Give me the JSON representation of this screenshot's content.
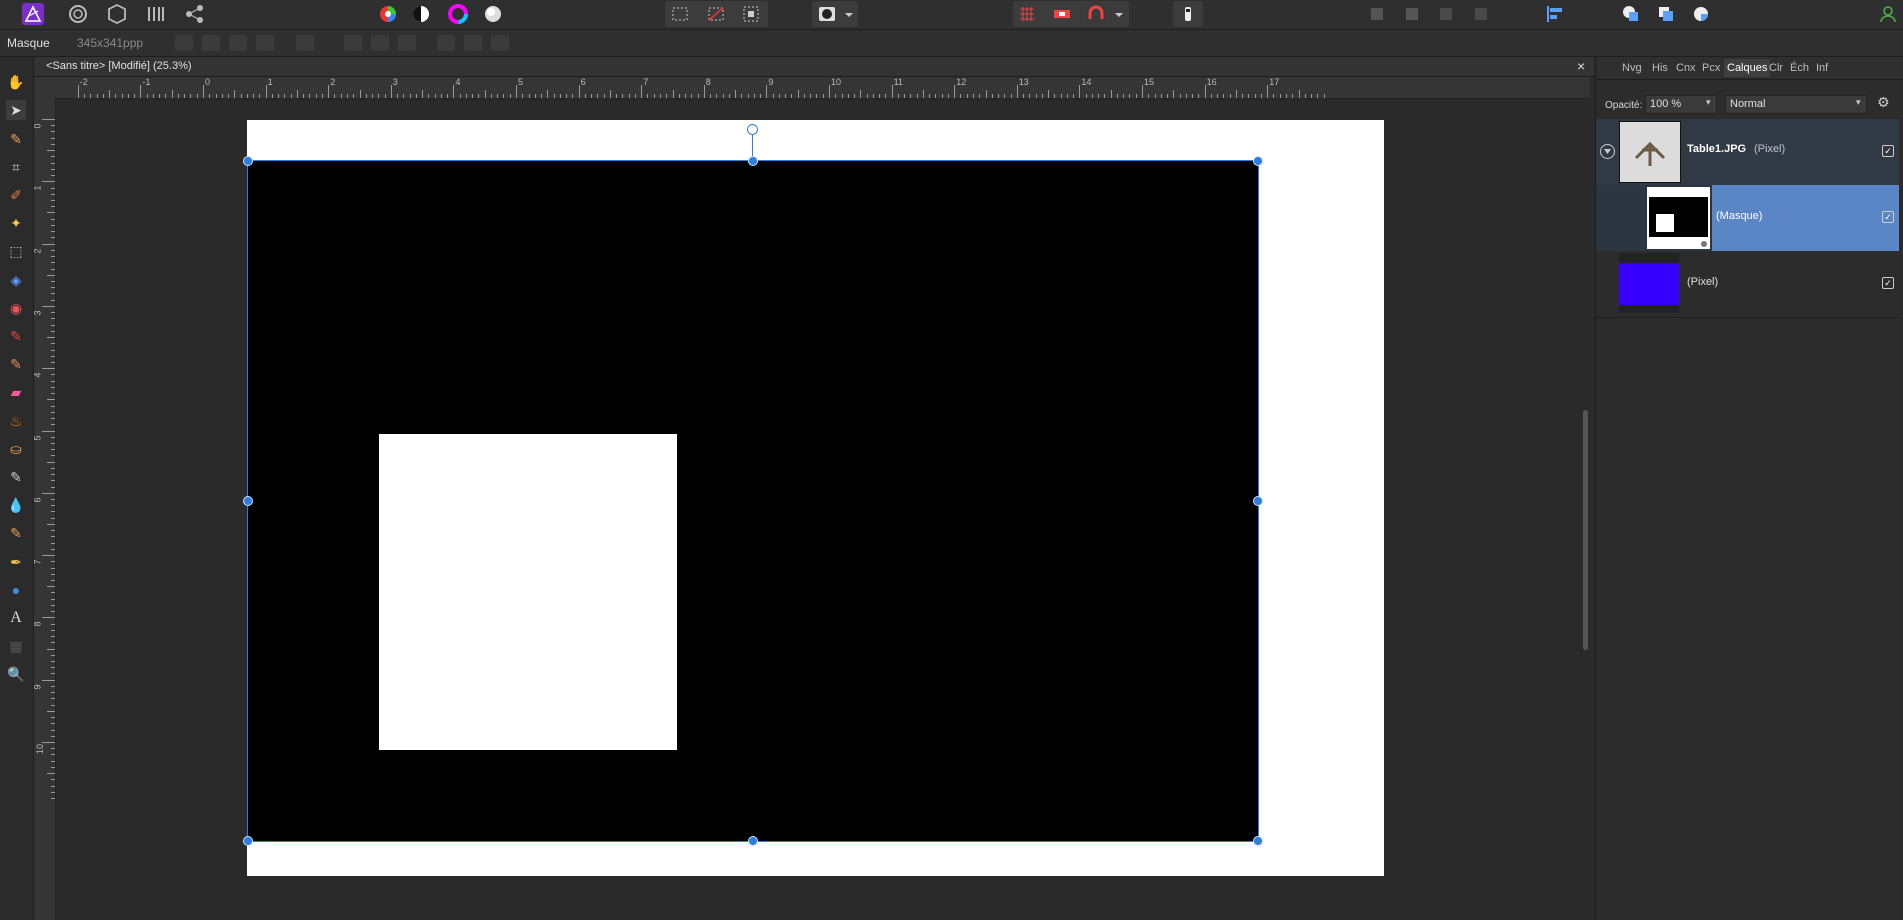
{
  "context": {
    "mode_label": "Masque",
    "dimensions": "345x341ppp"
  },
  "document": {
    "tab_title": "<Sans titre> [Modifié] (25.3%)",
    "close_glyph": "×"
  },
  "ruler": {
    "h_labels": [
      "-2",
      "-1",
      "0",
      "1",
      "2",
      "3",
      "4",
      "5",
      "6",
      "7",
      "8",
      "9",
      "10",
      "11",
      "12",
      "13",
      "14",
      "15",
      "16",
      "17"
    ],
    "v_labels": [
      "0",
      "1",
      "2",
      "3",
      "4",
      "5",
      "6",
      "7",
      "8",
      "9",
      "10"
    ]
  },
  "panel": {
    "tabs": [
      "Nvg",
      "His",
      "Cnx",
      "Pcx",
      "Calques",
      "Clr",
      "Éch",
      "Inf"
    ],
    "active_tab": "Calques",
    "opacity_label": "Opacité:",
    "opacity_value": "100 %",
    "blend_mode": "Normal",
    "layers": [
      {
        "name": "Table1.JPG",
        "type": "(Pixel)",
        "checked": "✓"
      },
      {
        "name": "",
        "type": "(Masque)",
        "checked": "✓"
      },
      {
        "name": "",
        "type": "(Pixel)",
        "checked": "✓"
      }
    ]
  },
  "colors": {
    "accent": "#2f7de1",
    "selected_layer": "#5b86c5",
    "pixel_layer_fill": "#3500ff",
    "app_logo": "#8a3ad1"
  }
}
